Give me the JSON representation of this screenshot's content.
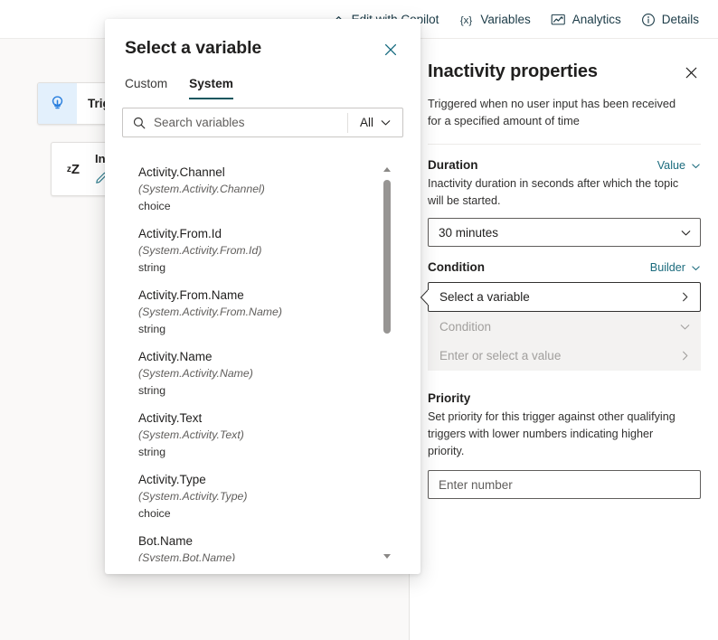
{
  "toolbar": {
    "items": [
      {
        "label": "Edit with Copilot",
        "icon": "copilot-icon"
      },
      {
        "label": "Variables",
        "icon": "variables-icon"
      },
      {
        "label": "Analytics",
        "icon": "analytics-icon"
      },
      {
        "label": "Details",
        "icon": "info-icon"
      }
    ]
  },
  "canvas": {
    "trigger_node": {
      "title": "Trigger",
      "icon": "trigger-icon"
    },
    "inactivity_node": {
      "title": "Inactivity",
      "icon": "sleep-zz-icon",
      "edit_icon": "pencil-icon"
    }
  },
  "dialog": {
    "title": "Select a variable",
    "close_icon": "close-icon",
    "tabs": [
      {
        "label": "Custom",
        "active": false
      },
      {
        "label": "System",
        "active": true
      }
    ],
    "search": {
      "placeholder": "Search variables",
      "icon": "search-icon",
      "filter_label": "All",
      "filter_icon": "chevron-down-icon"
    },
    "scrollbar": {
      "up_icon": "scroll-up-arrow-icon",
      "down_icon": "scroll-down-arrow-icon"
    },
    "variables": [
      {
        "name": "Activity.Channel",
        "path": "(System.Activity.Channel)",
        "type": "choice"
      },
      {
        "name": "Activity.From.Id",
        "path": "(System.Activity.From.Id)",
        "type": "string"
      },
      {
        "name": "Activity.From.Name",
        "path": "(System.Activity.From.Name)",
        "type": "string"
      },
      {
        "name": "Activity.Name",
        "path": "(System.Activity.Name)",
        "type": "string"
      },
      {
        "name": "Activity.Text",
        "path": "(System.Activity.Text)",
        "type": "string"
      },
      {
        "name": "Activity.Type",
        "path": "(System.Activity.Type)",
        "type": "choice"
      },
      {
        "name": "Bot.Name",
        "path": "(System.Bot.Name)",
        "type": ""
      }
    ]
  },
  "properties": {
    "title": "Inactivity properties",
    "close_icon": "close-icon",
    "subtitle": "Triggered when no user input has been received for a specified amount of time",
    "duration": {
      "title": "Duration",
      "mode_label": "Value",
      "mode_icon": "chevron-down-icon",
      "description": "Inactivity duration in seconds after which the topic will be started.",
      "value": "30 minutes",
      "dropdown_icon": "chevron-down-icon"
    },
    "condition": {
      "title": "Condition",
      "mode_label": "Builder",
      "mode_icon": "chevron-down-icon",
      "variable_row": {
        "label": "Select a variable",
        "icon": "chevron-right-icon"
      },
      "operator_row": {
        "label": "Condition",
        "icon": "chevron-down-icon"
      },
      "value_row": {
        "label": "Enter or select a value",
        "icon": "chevron-right-icon"
      }
    },
    "priority": {
      "title": "Priority",
      "description": "Set priority for this trigger against other qualifying triggers with lower numbers indicating higher priority.",
      "placeholder": "Enter number"
    }
  },
  "colors": {
    "accent_teal": "#13565e",
    "link_teal": "#1b6b7d",
    "trigger_blue": "#2a7fde",
    "canvas_bg": "#faf9f8"
  }
}
